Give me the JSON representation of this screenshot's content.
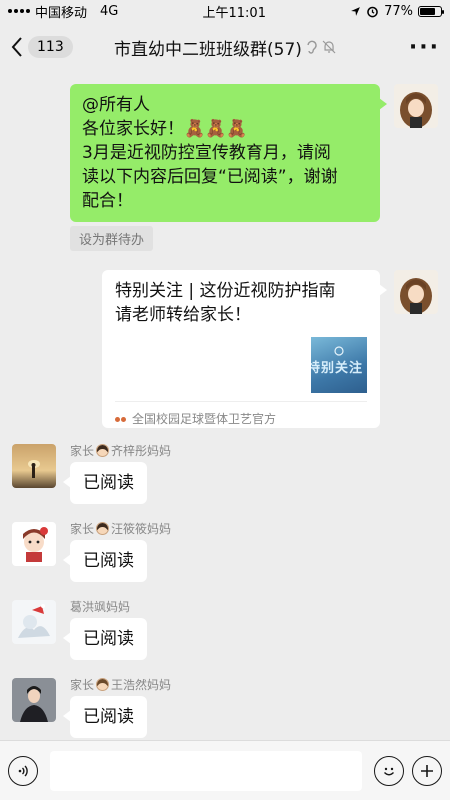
{
  "status_bar": {
    "carrier": "中国移动",
    "network": "4G",
    "time": "上午11:01",
    "battery": "77%",
    "battery_level": 0.77
  },
  "nav": {
    "unread_count": "113",
    "title": "市直幼中二班班级群(57)",
    "more_icon": "more-icon"
  },
  "messages": {
    "announcement": {
      "lines": [
        "@所有人",
        "各位家长好！🧸🧸🧸",
        "3月是近视防控宣传教育月，请阅",
        "读以下内容后回复“已阅读”，谢谢",
        "配合！"
      ],
      "todo_label": "设为群待办"
    },
    "link_card": {
      "title_line1": "特别关注 | 这份近视防护指南",
      "title_line2": "请老师转给家长！",
      "thumb_text": "特别关注",
      "source": "全国校园足球暨体卫艺官方"
    },
    "replies": [
      {
        "sender_prefix": "家长",
        "sender_name": "齐梓彤妈妈",
        "text": "已阅读"
      },
      {
        "sender_prefix": "家长",
        "sender_name": "汪筱筱妈妈",
        "text": "已阅读"
      },
      {
        "sender_prefix": "",
        "sender_name": "葛洪飒妈妈",
        "text": "已阅读"
      },
      {
        "sender_prefix": "家长",
        "sender_name": "王浩然妈妈",
        "text": "已阅读"
      }
    ]
  },
  "input_bar": {
    "voice_icon": "voice-icon",
    "emoji_icon": "emoji-icon",
    "plus_icon": "plus-icon"
  },
  "colors": {
    "background": "#ededed",
    "self_bubble": "#95ec69",
    "other_bubble": "#ffffff"
  }
}
